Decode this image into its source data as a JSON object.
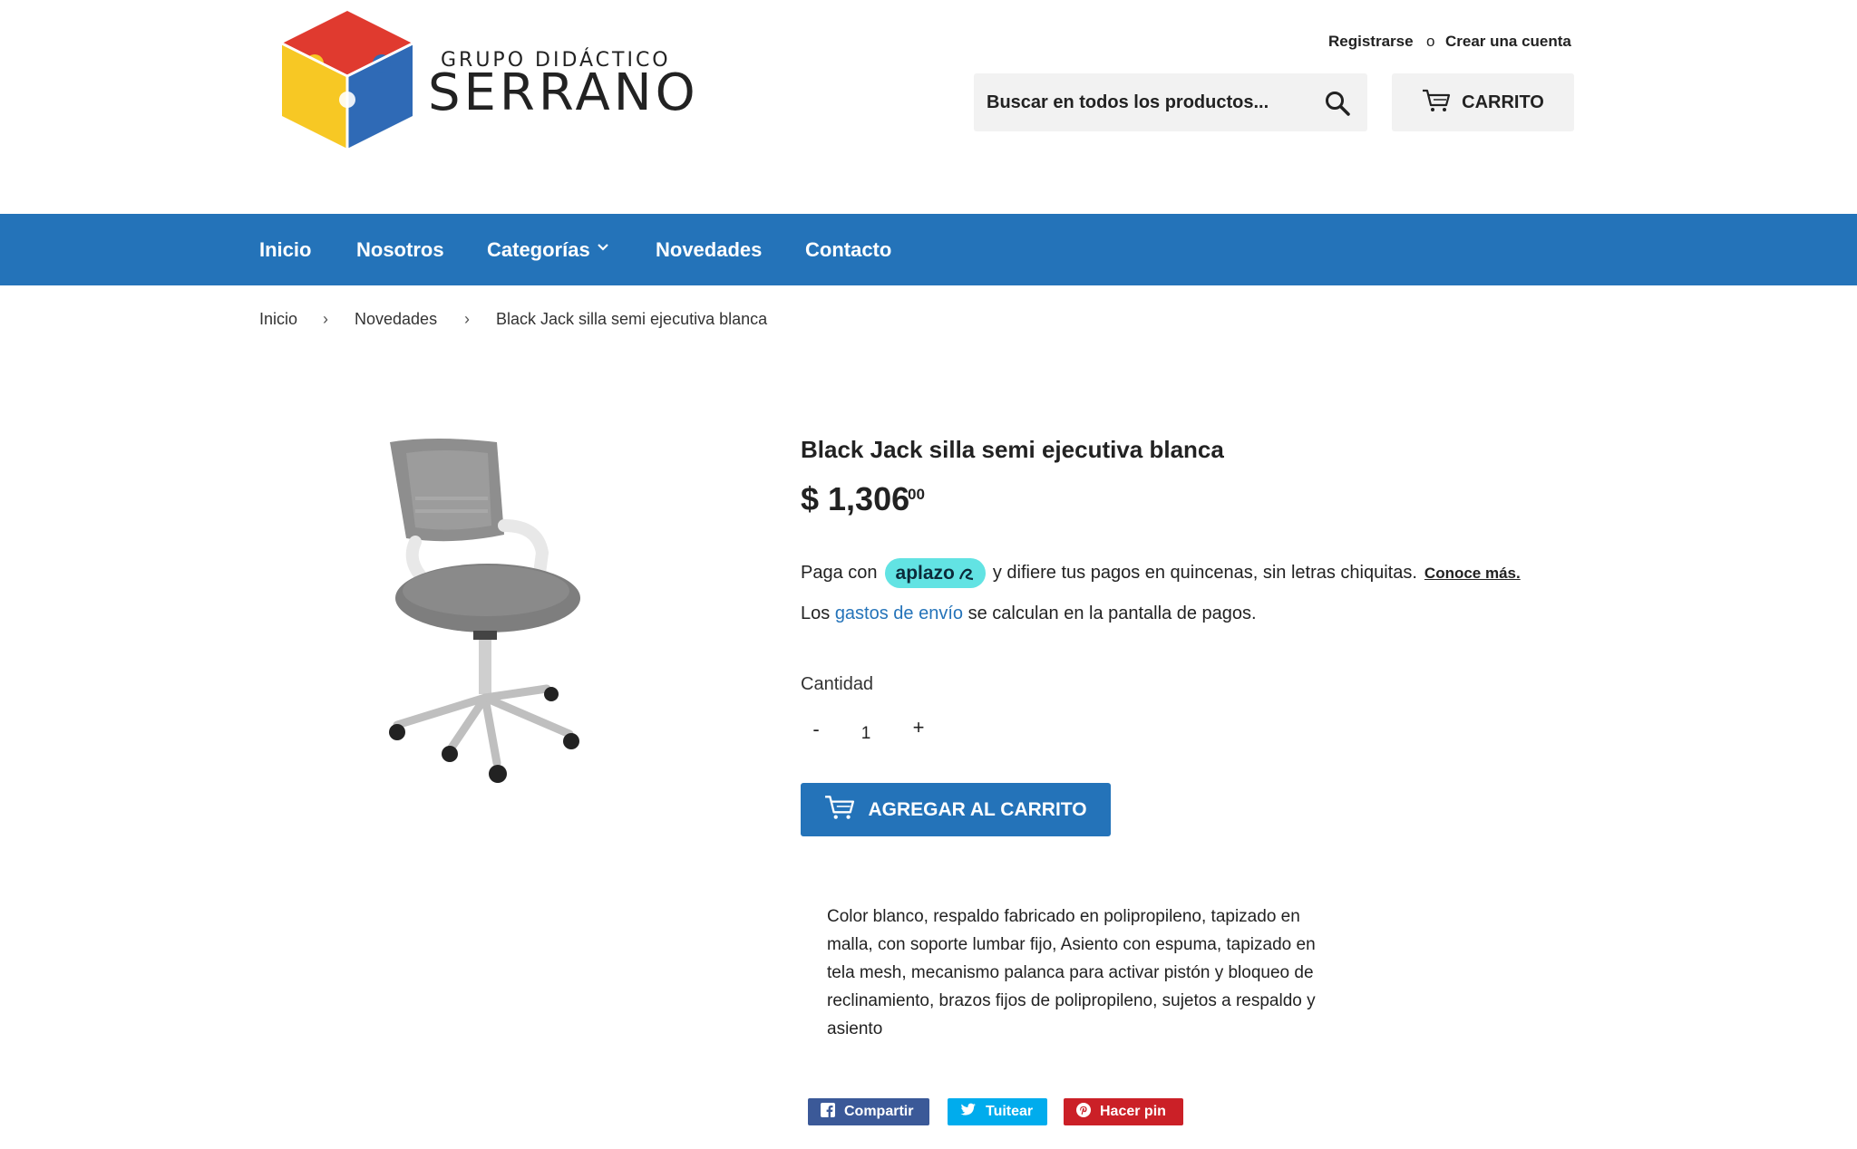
{
  "header": {
    "logo_small": "GRUPO DIDÁCTICO",
    "logo_big": "SERRANO",
    "register_label": "Registrarse",
    "or_label": "o",
    "create_account_label": "Crear una cuenta",
    "search_placeholder": "Buscar en todos los productos...",
    "cart_label": "CARRITO"
  },
  "nav": {
    "items": [
      "Inicio",
      "Nosotros",
      "Categorías",
      "Novedades",
      "Contacto"
    ]
  },
  "breadcrumb": [
    "Inicio",
    "Novedades",
    "Black Jack silla semi ejecutiva blanca"
  ],
  "product": {
    "title": "Black Jack silla semi ejecutiva blanca",
    "price": "$ 1,306",
    "price_cents": "00",
    "pay_prefix": "Paga con",
    "aplazo": "aplazo",
    "pay_suffix": "y difiere tus pagos en quincenas, sin letras chiquitas.",
    "pay_link": "Conoce más.",
    "ship_prefix": "Los",
    "ship_link": "gastos de envío",
    "ship_suffix": "se calculan en la pantalla de pagos.",
    "qty_label": "Cantidad",
    "qty_minus": "-",
    "qty_value": "1",
    "qty_plus": "+",
    "add_to_cart": "AGREGAR AL CARRITO",
    "description": "Color blanco, respaldo fabricado en polipropileno, tapizado en malla, con soporte lumbar fijo, Asiento con espuma, tapizado en tela mesh, mecanismo palanca para activar pistón y bloqueo de reclinamiento, brazos fijos de polipropileno, sujetos a respaldo y asiento"
  },
  "share": {
    "facebook": "Compartir",
    "twitter": "Tuitear",
    "pinterest": "Hacer pin"
  },
  "colors": {
    "brand_blue": "#2473b9",
    "aplazo": "#62e3e3",
    "facebook": "#3b5998",
    "twitter": "#00aced",
    "pinterest": "#cb2027"
  }
}
